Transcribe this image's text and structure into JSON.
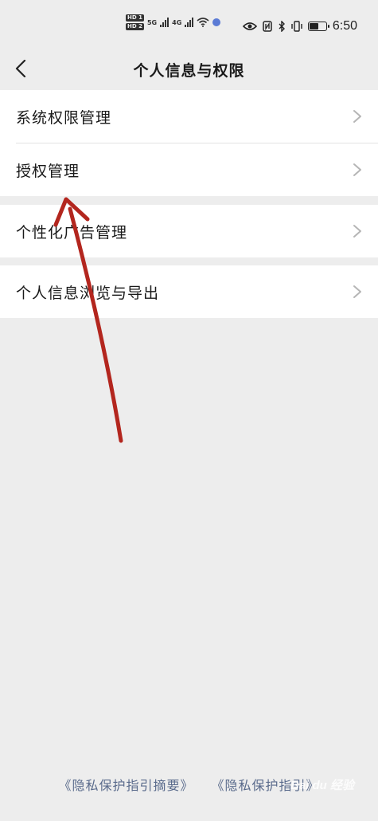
{
  "status_bar": {
    "hd1": "HD 1",
    "hd2": "HD 2",
    "net1": "5G",
    "net2": "4G",
    "time": "6:50"
  },
  "header": {
    "title": "个人信息与权限"
  },
  "groups": [
    {
      "items": [
        {
          "label": "系统权限管理"
        },
        {
          "label": "授权管理"
        }
      ]
    },
    {
      "items": [
        {
          "label": "个性化广告管理"
        }
      ]
    },
    {
      "items": [
        {
          "label": "个人信息浏览与导出"
        }
      ]
    }
  ],
  "footer": {
    "link1": "《隐私保护指引摘要》",
    "link2": "《隐私保护指引》"
  },
  "watermark": "Bai du 经验",
  "colors": {
    "background": "#ededed",
    "card": "#ffffff",
    "link": "#5a6b8c",
    "arrow": "#b3261e"
  }
}
